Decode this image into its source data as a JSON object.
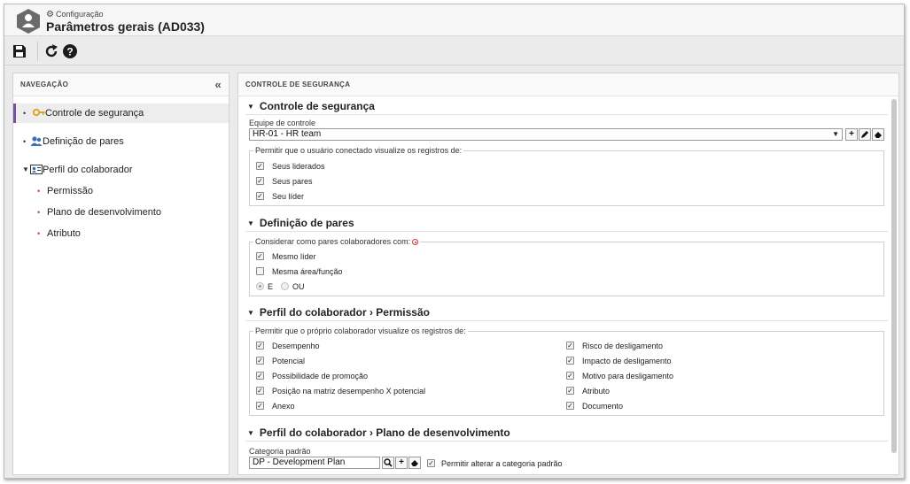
{
  "header": {
    "breadcrumb": "Configuração",
    "title": "Parâmetros gerais (AD033)"
  },
  "toolbar": {
    "icons": [
      "save-icon",
      "refresh-icon",
      "help-icon"
    ]
  },
  "nav": {
    "title": "NAVEGAÇÃO",
    "items": [
      {
        "label": "Controle de segurança",
        "icon": "key-icon"
      },
      {
        "label": "Definição de pares",
        "icon": "users-icon"
      },
      {
        "label": "Perfil do colaborador",
        "icon": "profile-card-icon"
      }
    ],
    "subitems": [
      {
        "label": "Permissão"
      },
      {
        "label": "Plano de desenvolvimento"
      },
      {
        "label": "Atributo"
      }
    ]
  },
  "main": {
    "panel_title": "CONTROLE DE SEGURANÇA",
    "security": {
      "heading": "Controle de segurança",
      "team_label": "Equipe de controle",
      "team_value": "HR-01 - HR team",
      "allow_legend": "Permitir que o usuário conectado visualize os registros de:",
      "options": [
        {
          "label": "Seus liderados",
          "checked": true
        },
        {
          "label": "Seus pares",
          "checked": true
        },
        {
          "label": "Seu líder",
          "checked": true
        }
      ]
    },
    "peers": {
      "heading": "Definição de pares",
      "consider_legend": "Considerar como pares colaboradores com:",
      "options": [
        {
          "label": "Mesmo líder",
          "checked": true
        },
        {
          "label": "Mesma área/função",
          "checked": false
        }
      ],
      "radio_e": "E",
      "radio_ou": "OU"
    },
    "permission": {
      "heading": "Perfil do colaborador › Permissão",
      "legend": "Permitir que o próprio colaborador visualize os registros de:",
      "left": [
        {
          "label": "Desempenho",
          "checked": true
        },
        {
          "label": "Potencial",
          "checked": true
        },
        {
          "label": "Possibilidade de promoção",
          "checked": true
        },
        {
          "label": "Posição na matriz desempenho X potencial",
          "checked": true
        },
        {
          "label": "Anexo",
          "checked": true
        }
      ],
      "right": [
        {
          "label": "Risco de desligamento",
          "checked": true
        },
        {
          "label": "Impacto de desligamento",
          "checked": true
        },
        {
          "label": "Motivo para desligamento",
          "checked": true
        },
        {
          "label": "Atributo",
          "checked": true
        },
        {
          "label": "Documento",
          "checked": true
        }
      ]
    },
    "plan": {
      "heading": "Perfil do colaborador › Plano de desenvolvimento",
      "category_label": "Categoria padrão",
      "category_value": "DP - Development Plan",
      "allow_change_label": "Permitir alterar a categoria padrão",
      "allow_change_checked": true
    }
  },
  "colors": {
    "active_nav_border": "#7a4ea3",
    "key_icon": "#e0a020",
    "users_icon": "#3d6fb5",
    "required": "#d33333"
  }
}
